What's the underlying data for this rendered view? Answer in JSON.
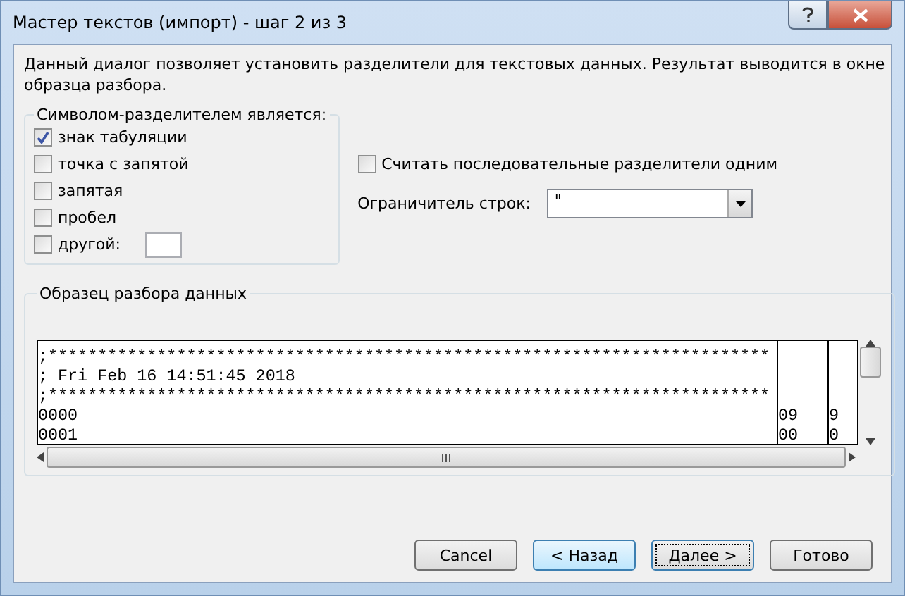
{
  "window": {
    "title": "Мастер текстов (импорт) - шаг 2 из 3"
  },
  "description": "Данный диалог позволяет установить разделители для текстовых данных. Результат выводится в окне образца разбора.",
  "delimiters": {
    "title": "Символом-разделителем является:",
    "items": [
      {
        "label": "знак табуляции",
        "checked": true
      },
      {
        "label": "точка с запятой",
        "checked": false
      },
      {
        "label": "запятая",
        "checked": false
      },
      {
        "label": "пробел",
        "checked": false
      },
      {
        "label": "другой:",
        "checked": false,
        "has_field": true
      }
    ]
  },
  "consecutive": {
    "label": "Считать последовательные разделители одним",
    "checked": false
  },
  "text_qualifier": {
    "label": "Ограничитель строк:",
    "value": "\""
  },
  "preview": {
    "title": "Образец разбора данных",
    "rows": [
      [
        ";*************************************************************************",
        "",
        ""
      ],
      [
        "; Fri Feb 16 14:51:45 2018",
        "",
        ""
      ],
      [
        ";*************************************************************************",
        "",
        ""
      ],
      [
        "0000",
        "09",
        "9"
      ],
      [
        "0001",
        "00",
        "0"
      ]
    ]
  },
  "buttons": [
    {
      "label": "Cancel",
      "kind": "normal"
    },
    {
      "label": "< Назад",
      "kind": "hover"
    },
    {
      "label": "Далее >",
      "kind": "default"
    },
    {
      "label": "Готово",
      "kind": "normal"
    }
  ]
}
